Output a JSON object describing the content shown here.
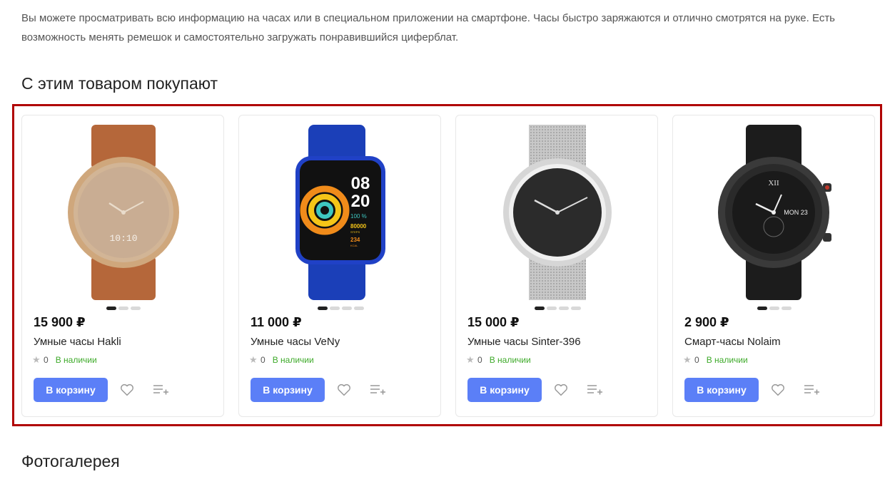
{
  "description": "Вы можете просматривать всю информацию на часах или в специальном приложении на смартфоне. Часы быстро заряжаются и отлично смотрятся на руке. Есть возможность менять ремешок и самостоятельно загружать понравившийся циферблат.",
  "related_title": "С этим товаром покупают",
  "gallery_title": "Фотогалерея",
  "colors": {
    "accent": "#5b7ff7",
    "in_stock": "#3eaa2a",
    "highlight": "#b00000"
  },
  "products": [
    {
      "price": "15 900 ₽",
      "name": "Умные часы Hakli",
      "rating": "0",
      "stock": "В наличии",
      "button": "В корзину",
      "image_icon": "gold-analog-watch-image",
      "slides": 3,
      "active_slide": 0
    },
    {
      "price": "11 000 ₽",
      "name": "Умные часы VeNy",
      "rating": "0",
      "stock": "В наличии",
      "button": "В корзину",
      "image_icon": "blue-smartwatch-image",
      "slides": 4,
      "active_slide": 0
    },
    {
      "price": "15 000 ₽",
      "name": "Умные часы Sinter-396",
      "rating": "0",
      "stock": "В наличии",
      "button": "В корзину",
      "image_icon": "silver-mesh-watch-image",
      "slides": 4,
      "active_slide": 0
    },
    {
      "price": "2 900 ₽",
      "name": "Смарт-часы Nolaim",
      "rating": "0",
      "stock": "В наличии",
      "button": "В корзину",
      "image_icon": "black-sport-watch-image",
      "slides": 3,
      "active_slide": 0
    }
  ],
  "watch_faces": {
    "hakli_time": "10:10",
    "veny_hour": "08",
    "veny_minute": "20",
    "veny_percent": "100 %",
    "veny_steps": "80000",
    "veny_steps_label": "STEPS",
    "veny_kcal": "234",
    "veny_kcal_label": "KCAL",
    "nolaim_date": "MON 23",
    "nolaim_numeral": "XII"
  }
}
